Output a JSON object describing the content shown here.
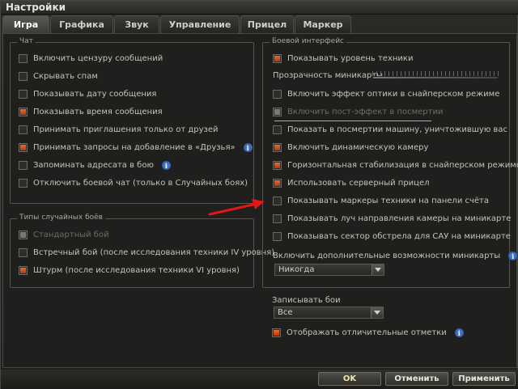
{
  "window": {
    "title": "Настройки"
  },
  "tabs": [
    {
      "label": "Игра",
      "active": true
    },
    {
      "label": "Графика",
      "active": false
    },
    {
      "label": "Звук",
      "active": false
    },
    {
      "label": "Управление",
      "active": false
    },
    {
      "label": "Прицел",
      "active": false
    },
    {
      "label": "Маркер",
      "active": false
    }
  ],
  "chat": {
    "title": "Чат",
    "items": [
      {
        "label": "Включить цензуру сообщений",
        "checked": false
      },
      {
        "label": "Скрывать спам",
        "checked": false
      },
      {
        "label": "Показывать дату сообщения",
        "checked": false
      },
      {
        "label": "Показывать время сообщения",
        "checked": true
      },
      {
        "label": "Принимать приглашения только от друзей",
        "checked": false
      },
      {
        "label": "Принимать запросы на добавление в «Друзья»",
        "checked": true
      },
      {
        "label": "Запоминать адресата в бою",
        "checked": false
      },
      {
        "label": "Отключить боевой чат (только в Случайных боях)",
        "checked": false
      }
    ]
  },
  "battle_types": {
    "title": "Типы случайных боёв",
    "items": [
      {
        "label": "Стандартный бой",
        "checked": true,
        "disabled": true
      },
      {
        "label": "Встречный бой (после исследования техники IV уровня)",
        "checked": false
      },
      {
        "label": "Штурм (после исследования техники VI уровня)",
        "checked": true
      }
    ]
  },
  "battle_interface": {
    "title": "Боевой интерфейс",
    "show_tier": {
      "label": "Показывать уровень техники",
      "checked": true
    },
    "minimap_opacity": {
      "label": "Прозрачность миникарты"
    },
    "items": [
      {
        "label": "Включить эффект оптики в снайперском режиме",
        "checked": false
      },
      {
        "label": "Включить пост-эффект в посмертии",
        "checked": true,
        "disabled": true
      },
      {
        "label": "Показать в посмертии машину, уничтожившую вас",
        "checked": false
      },
      {
        "label": "Включить динамическую камеру",
        "checked": true
      },
      {
        "label": "Горизонтальная стабилизация в снайперском режиме",
        "checked": true
      },
      {
        "label": "Использовать серверный прицел",
        "checked": true
      },
      {
        "label": "Показывать маркеры техники на панели счёта",
        "checked": false
      },
      {
        "label": "Показывать луч направления камеры на миникарте",
        "checked": false
      },
      {
        "label": "Показывать сектор обстрела для САУ на миникарте",
        "checked": false
      }
    ],
    "minimap_extra": {
      "label": "Включить дополнительные возможности миникарты",
      "value": "Никогда"
    }
  },
  "replays": {
    "label": "Записывать бои",
    "value": "Все"
  },
  "marks": {
    "label": "Отображать отличительные отметки",
    "checked": true
  },
  "footer": {
    "ok": "OK",
    "cancel": "Отменить",
    "apply": "Применить"
  },
  "colors": {
    "accent": "#e05a20",
    "info": "#2f6cc8",
    "highlight": "#c7b04a",
    "arrow": "#e01818"
  }
}
